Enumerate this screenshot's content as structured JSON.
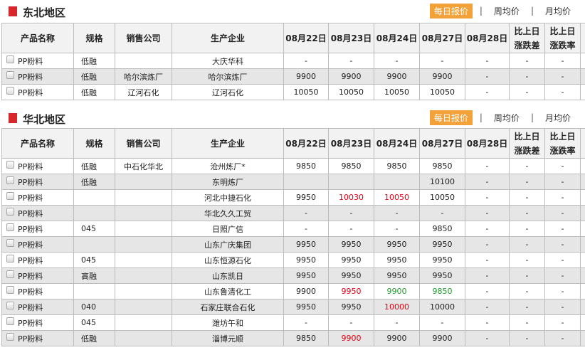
{
  "tabs": [
    "每日报价",
    "周均价",
    "月均价"
  ],
  "tab_separator": "|",
  "headers": [
    "产品名称",
    "规格",
    "销售公司",
    "生产企业",
    "08月22日",
    "08月23日",
    "08月24日",
    "08月27日",
    "08月28日",
    "比上日涨跌差",
    "比上日涨跌率"
  ],
  "headers_split": {
    "diff": [
      "比上日",
      "涨跌差"
    ],
    "rate": [
      "比上日",
      "涨跌率"
    ]
  },
  "sections": [
    {
      "title": "东北地区",
      "rows": [
        {
          "product": "PP粉料",
          "spec": "低融",
          "seller": "",
          "producer": "大庆华科",
          "d1": "-",
          "d2": "-",
          "d3": "-",
          "d4": "-",
          "d5": "-",
          "diff": "-",
          "rate": "-"
        },
        {
          "product": "PP粉料",
          "spec": "低融",
          "seller": "哈尔滨炼厂",
          "producer": "哈尔滨炼厂",
          "d1": "9900",
          "d2": "9900",
          "d3": "9900",
          "d4": "9900",
          "d5": "-",
          "diff": "-",
          "rate": "-"
        },
        {
          "product": "PP粉料",
          "spec": "低融",
          "seller": "辽河石化",
          "producer": "辽河石化",
          "d1": "10050",
          "d2": "10050",
          "d3": "10050",
          "d4": "10050",
          "d5": "-",
          "diff": "-",
          "rate": "-"
        }
      ]
    },
    {
      "title": "华北地区",
      "rows": [
        {
          "product": "PP粉料",
          "spec": "低融",
          "seller": "中石化华北",
          "producer": "沧州炼厂*",
          "d1": "9850",
          "d2": "9850",
          "d3": "9850",
          "d4": "9850",
          "d5": "-",
          "diff": "-",
          "rate": "-"
        },
        {
          "product": "PP粉料",
          "spec": "低融",
          "seller": "",
          "producer": "东明炼厂",
          "d1": "",
          "d2": "",
          "d3": "",
          "d4": "10100",
          "d5": "-",
          "diff": "-",
          "rate": "-"
        },
        {
          "product": "PP粉料",
          "spec": "",
          "seller": "",
          "producer": "河北中捷石化",
          "d1": "9950",
          "d2": "10030",
          "d2_color": "up",
          "d3": "10050",
          "d3_color": "up",
          "d4": "10050",
          "d5": "-",
          "diff": "-",
          "rate": "-"
        },
        {
          "product": "PP粉料",
          "spec": "",
          "seller": "",
          "producer": "华北久久工贸",
          "d1": "-",
          "d2": "-",
          "d3": "-",
          "d4": "-",
          "d5": "-",
          "diff": "-",
          "rate": "-"
        },
        {
          "product": "PP粉料",
          "spec": "045",
          "seller": "",
          "producer": "日照广信",
          "d1": "-",
          "d2": "-",
          "d3": "-",
          "d4": "9850",
          "d5": "-",
          "diff": "-",
          "rate": "-"
        },
        {
          "product": "PP粉料",
          "spec": "",
          "seller": "",
          "producer": "山东广庆集团",
          "d1": "9950",
          "d2": "9950",
          "d3": "9950",
          "d4": "9950",
          "d5": "-",
          "diff": "-",
          "rate": "-"
        },
        {
          "product": "PP粉料",
          "spec": "045",
          "seller": "",
          "producer": "山东恒源石化",
          "d1": "9950",
          "d2": "9950",
          "d3": "9950",
          "d4": "9950",
          "d5": "-",
          "diff": "-",
          "rate": "-"
        },
        {
          "product": "PP粉料",
          "spec": "高融",
          "seller": "",
          "producer": "山东凯日",
          "d1": "9950",
          "d2": "9950",
          "d3": "9950",
          "d4": "9950",
          "d5": "-",
          "diff": "-",
          "rate": "-"
        },
        {
          "product": "PP粉料",
          "spec": "",
          "seller": "",
          "producer": "山东鲁清化工",
          "d1": "9900",
          "d2": "9950",
          "d2_color": "up",
          "d3": "9900",
          "d3_color": "down",
          "d4": "9850",
          "d4_color": "down",
          "d5": "-",
          "diff": "-",
          "rate": "-"
        },
        {
          "product": "PP粉料",
          "spec": "040",
          "seller": "",
          "producer": "石家庄联合石化",
          "d1": "9950",
          "d2": "9950",
          "d3": "10000",
          "d3_color": "up",
          "d4": "10000",
          "d5": "-",
          "diff": "-",
          "rate": "-"
        },
        {
          "product": "PP粉料",
          "spec": "045",
          "seller": "",
          "producer": "潍坊午和",
          "d1": "-",
          "d2": "-",
          "d3": "-",
          "d4": "-",
          "d5": "-",
          "diff": "-",
          "rate": "-"
        },
        {
          "product": "PP粉料",
          "spec": "低融",
          "seller": "",
          "producer": "淄博元顺",
          "d1": "9850",
          "d2": "9900",
          "d2_color": "up",
          "d3": "9900",
          "d4": "9900",
          "d5": "-",
          "diff": "-",
          "rate": "-"
        }
      ]
    }
  ]
}
